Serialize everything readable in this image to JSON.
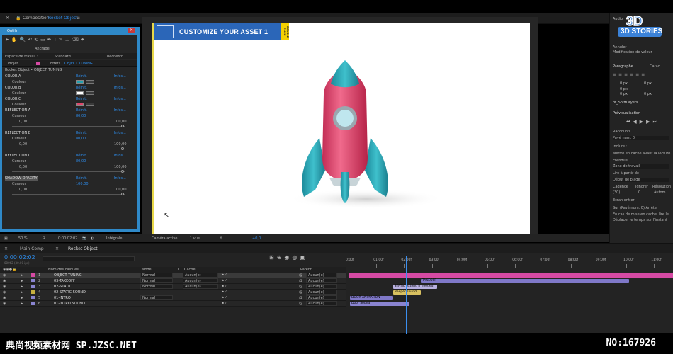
{
  "app": {
    "composition_tab_prefix": "Composition",
    "composition_tab_name": "Rocket Object",
    "menu_icon": "hamburger-icon"
  },
  "tools": {
    "title": "Outils",
    "align_label": "Ancrage",
    "workspace_label": "Espace de travail :",
    "workspace_value": "Standard",
    "search_placeholder": "Recherch"
  },
  "effects_panel": {
    "tab_project": "Projet",
    "tab_effects": "Effets",
    "tab_effects_layer": "OBJECT TUNING",
    "breadcrumb": "Rocket Object • OBJECT TUNING",
    "reinit": "Réinit.",
    "info": "Infos...",
    "rows": [
      {
        "name": "COLOR A",
        "sub": "Couleur",
        "color": "#22a0b0"
      },
      {
        "name": "COLOR B",
        "sub": "Couleur",
        "color": "#ffffff"
      },
      {
        "name": "COLOR C",
        "sub": "Couleur",
        "color": "#e0466a"
      }
    ],
    "reflections": [
      {
        "name": "REFLECTION A",
        "sub": "Curseur",
        "value": "80,00",
        "min": "0,00",
        "max": "100,00"
      },
      {
        "name": "REFLECTION B",
        "sub": "Curseur",
        "value": "80,00",
        "min": "0,00",
        "max": "100,00"
      },
      {
        "name": "REFLECTION C",
        "sub": "Curseur",
        "value": "80,00",
        "min": "0,00",
        "max": "100,00"
      },
      {
        "name": "SHADOW OPACITY",
        "sub": "Curseur",
        "value": "100,00",
        "min": "0,00",
        "max": "100,00"
      }
    ]
  },
  "viewer": {
    "banner_text": "CUSTOMIZE YOUR ASSET 1",
    "tag_text": "DOUBLE CLICK",
    "zoom": "50 %",
    "timecode": "0:00:02:02",
    "resolution": "Intégrale",
    "camera": "Caméra active",
    "views": "1 vue",
    "exposure": "+0,0"
  },
  "right_panel": {
    "brand": "3D STORIES",
    "audio": "Audio",
    "undo": "Annuler",
    "modify": "Modification de valeur",
    "paragraph": "Paragraphe",
    "chars": "Carac",
    "indent_values": [
      "0 px",
      "0 px",
      "0 px",
      "0 px",
      "0 px"
    ],
    "script": "pt_ShiftLayers",
    "preview": "Prévisualisation",
    "shortcut_label": "Raccourci",
    "shortcut_value": "Pavé num. 0",
    "include": "Inclure :",
    "cache_label": "Mettre en cache avant la lecture",
    "range_label": "Etendue",
    "range_value": "Zone de travail",
    "play_from_label": "Lire à partir de",
    "play_from_value": "Début de plage",
    "framerate": "Cadence",
    "skip": "Ignorer",
    "resolution": "Résolution",
    "framerate_value": "(30)",
    "skip_value": "0",
    "resolution_value": "Autom...",
    "fullscreen": "Ecran entier",
    "stop_label": "Sur (Pavé num. 0) Arrêter :",
    "stop_opt1": "En cas de mise en cache, lire le",
    "stop_opt2": "Déplacer le temps sur l'instant"
  },
  "timeline": {
    "tab_main": "Main Comp",
    "tab_rocket": "Rocket Object",
    "current_time": "0:00:02:02",
    "current_time_sub": "00062 (30.00 ips)",
    "col_name": "Nom des calques",
    "col_mode": "Mode",
    "col_t": "T",
    "col_cache": "Cache",
    "col_parent": "Parent",
    "ruler": [
      "0:00f",
      "01:00f",
      "02:00f",
      "03:00f",
      "04:00f",
      "05:00f",
      "06:00f",
      "07:00f",
      "08:00f",
      "09:00f",
      "10:00f",
      "11:00f"
    ],
    "layers": [
      {
        "num": "1",
        "name": "OBJECT TUNING",
        "mode": "Normal",
        "cache": "Aucun(e)",
        "parent": "Aucun(e)",
        "color": "#d64aa4"
      },
      {
        "num": "2",
        "name": "03-TAKEOFF",
        "mode": "Normal",
        "cache": "Aucun(e)",
        "parent": "Aucun(e)",
        "color": "#8a84d0"
      },
      {
        "num": "3",
        "name": "02-STATIC",
        "mode": "Normal",
        "cache": "Aucun(e)",
        "parent": "Aucun(e)",
        "color": "#8a84d0"
      },
      {
        "num": "4",
        "name": "02-STATIC SOUND",
        "mode": "",
        "cache": "",
        "parent": "Aucun(e)",
        "color": "#c8b040"
      },
      {
        "num": "5",
        "name": "01-INTRO",
        "mode": "Normal",
        "cache": "",
        "parent": "Aucun(e)",
        "color": "#8a84d0"
      },
      {
        "num": "6",
        "name": "01-INTRO SOUND",
        "mode": "",
        "cache": "",
        "parent": "Aucun(e)",
        "color": "#8a84d0"
      }
    ],
    "bars": [
      {
        "label": "",
        "color": "#d64aa4",
        "start": 0,
        "end": 11.9
      },
      {
        "label": "TAKEOFF",
        "color": "#7f78c8",
        "start": 2.6,
        "end": 10.1
      },
      {
        "label": "STATIC extend if needed",
        "color": "#b8b0e0",
        "start": 1.6,
        "end": 3.2
      },
      {
        "label": "Beeper sound",
        "color": "#d8c060",
        "start": 1.6,
        "end": 2.6
      },
      {
        "label": "DOOR ANIMATION",
        "color": "#7f78c8",
        "start": 0.05,
        "end": 1.6
      },
      {
        "label": "Door Sound",
        "color": "#8a84d0",
        "start": 0.05,
        "end": 2.2
      }
    ],
    "playhead_time": 2.07
  },
  "watermark": {
    "left": "典尚视频素材网 SP.JZSC.NET",
    "right": "NO:167926"
  }
}
